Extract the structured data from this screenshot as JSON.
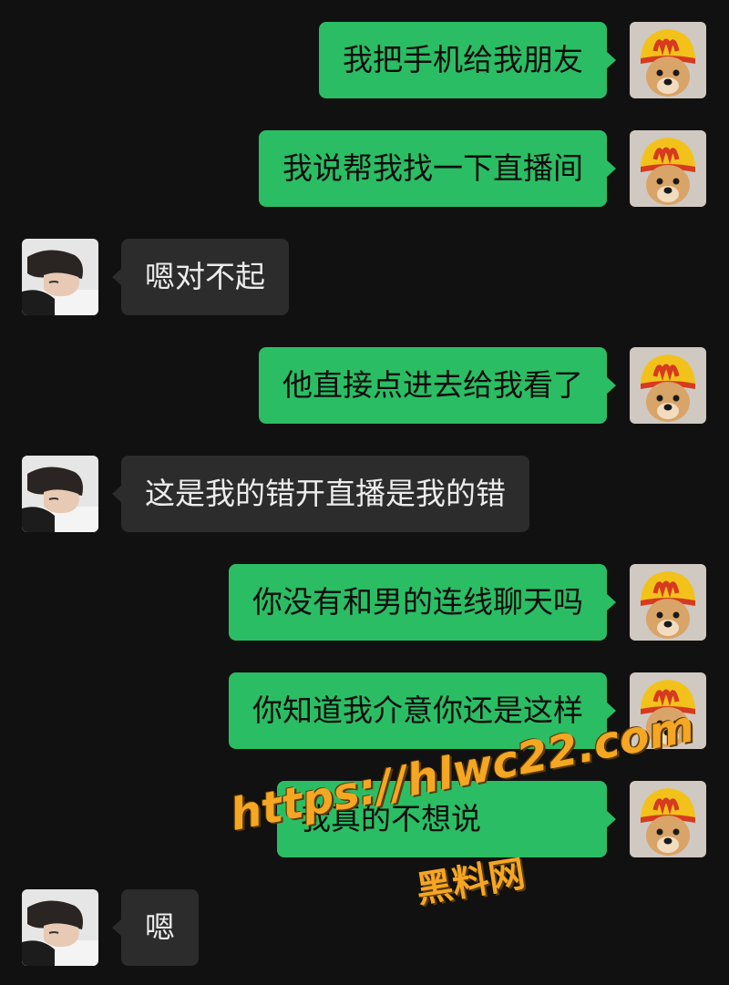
{
  "colors": {
    "background": "#111111",
    "outgoing_bubble": "#2bbd63",
    "incoming_bubble": "#2c2c2c",
    "watermark": "#f5a623"
  },
  "avatars": {
    "me": "dog-in-mcdonalds-hat-avatar",
    "other": "person-lying-down-avatar"
  },
  "messages": [
    {
      "side": "right",
      "text": "我把手机给我朋友"
    },
    {
      "side": "right",
      "text": "我说帮我找一下直播间"
    },
    {
      "side": "left",
      "text": "嗯对不起"
    },
    {
      "side": "right",
      "text": "他直接点进去给我看了"
    },
    {
      "side": "left",
      "text": "这是我的错开直播是我的错"
    },
    {
      "side": "right",
      "text": "你没有和男的连线聊天吗"
    },
    {
      "side": "right",
      "text": "你知道我介意你还是这样"
    },
    {
      "side": "right",
      "text": "我真的不想说"
    },
    {
      "side": "left",
      "text": "嗯"
    }
  ],
  "watermark": {
    "url": "https://hlwc22.com",
    "site": "黑料网"
  }
}
